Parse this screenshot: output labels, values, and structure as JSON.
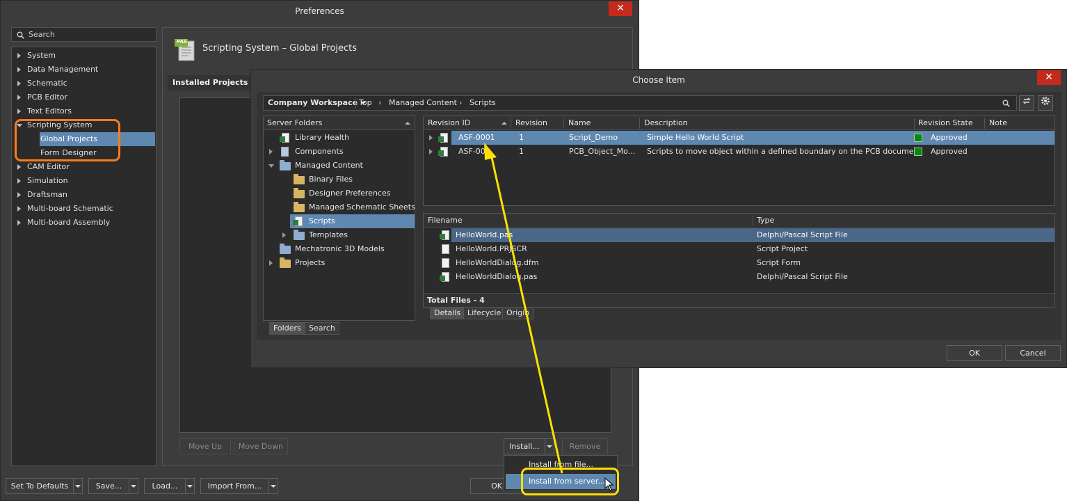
{
  "prefs": {
    "title": "Preferences",
    "close": "✕",
    "search_placeholder": "Search",
    "nav": [
      "System",
      "Data Management",
      "Schematic",
      "PCB Editor",
      "Text Editors",
      "Scripting System",
      "CAM Editor",
      "Simulation",
      "Draftsman",
      "Multi-board Schematic",
      "Multi-board Assembly"
    ],
    "nav_sub": [
      "Global Projects",
      "Form Designer"
    ],
    "page_icon_text": "PAS",
    "page_title": "Scripting System – Global Projects",
    "installed_header": "Installed Projects",
    "buttons": {
      "move_up": "Move Up",
      "move_down": "Move Down",
      "install": "Install...",
      "remove": "Remove",
      "set_defaults": "Set To Defaults",
      "save": "Save...",
      "load": "Load...",
      "import": "Import From...",
      "ok": "OK"
    },
    "install_menu": [
      "Install from file...",
      "Install from server..."
    ]
  },
  "choose": {
    "title": "Choose Item",
    "close": "✕",
    "workspace": "Company Workspace",
    "breadcrumb": [
      "Top",
      "Managed Content",
      "Scripts"
    ],
    "folders_header": "Server Folders",
    "folders": [
      {
        "label": "Library Health"
      },
      {
        "label": "Components"
      },
      {
        "label": "Managed Content"
      },
      {
        "label": "Binary Files"
      },
      {
        "label": "Designer Preferences"
      },
      {
        "label": "Managed Schematic Sheets"
      },
      {
        "label": "Scripts"
      },
      {
        "label": "Templates"
      },
      {
        "label": "Mechatronic 3D Models"
      },
      {
        "label": "Projects"
      }
    ],
    "folder_tabs": [
      "Folders",
      "Search"
    ],
    "rev_columns": [
      "Revision ID",
      "Revision",
      "Name",
      "Description",
      "Revision State",
      "Note"
    ],
    "revisions": [
      {
        "id": "ASF-0001",
        "rev": "1",
        "name": "Script_Demo",
        "desc": "Simple Hello World Script",
        "state": "Approved"
      },
      {
        "id": "ASF-000",
        "rev": "1",
        "name": "PCB_Object_Mo...",
        "desc": "Scripts to move object within a defined boundary on the PCB document",
        "state": "Approved"
      }
    ],
    "file_columns": [
      "Filename",
      "Type"
    ],
    "files": [
      {
        "name": "HelloWorld.pas",
        "type": "Delphi/Pascal Script File"
      },
      {
        "name": "HelloWorld.PRJSCR",
        "type": "Script Project"
      },
      {
        "name": "HelloWorldDialog.dfm",
        "type": "Script Form"
      },
      {
        "name": "HelloWorldDialog.pas",
        "type": "Delphi/Pascal Script File"
      }
    ],
    "total_files": "Total Files - 4",
    "detail_tabs": [
      "Details",
      "Lifecycle",
      "Origin"
    ],
    "ok": "OK",
    "cancel": "Cancel"
  },
  "colors": {
    "accent_select": "#5f88b1",
    "highlight_orange": "#ff7a1a",
    "highlight_yellow": "#ffe000",
    "approved_green": "#0a8a0a",
    "close_red": "#c42b1c"
  }
}
